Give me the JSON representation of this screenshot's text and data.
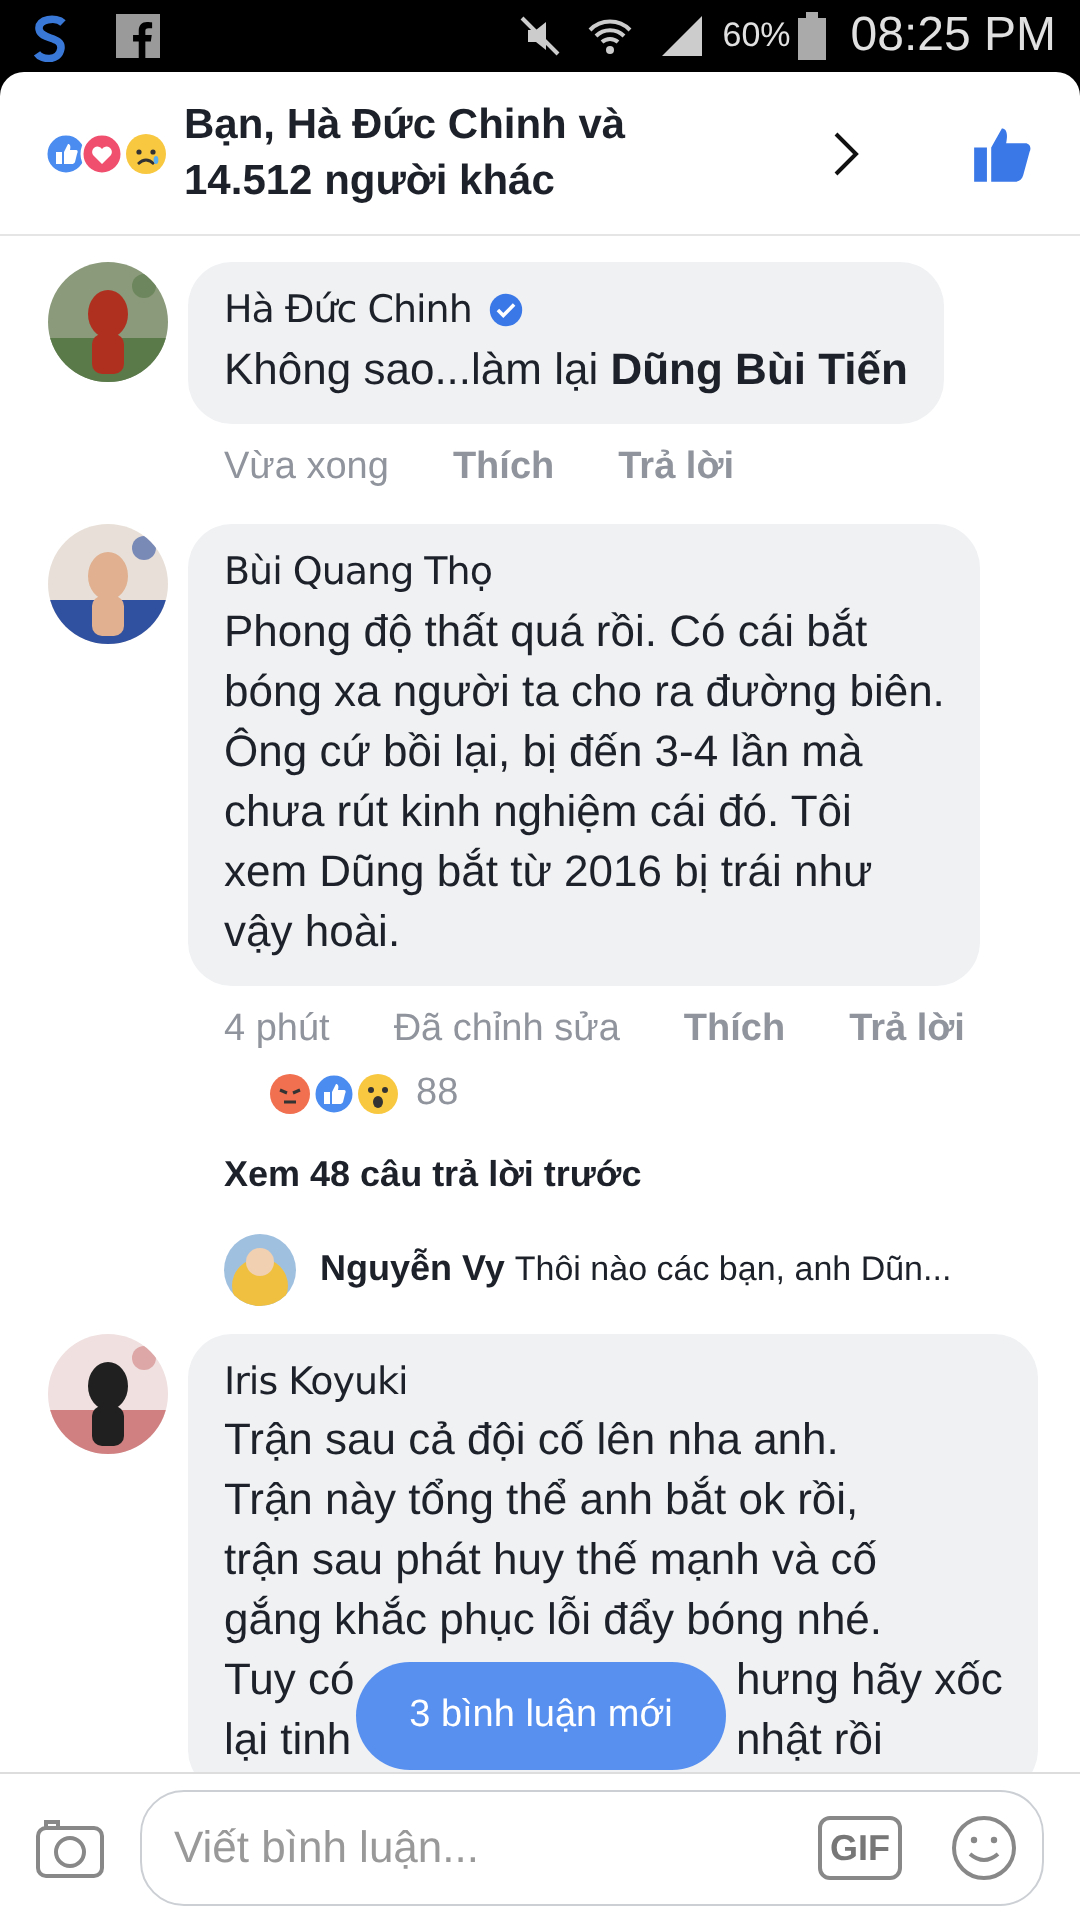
{
  "status_bar": {
    "battery": "60%",
    "time": "08:25 PM"
  },
  "reactions_header": {
    "lines": [
      "Bạn, Hà Đức Chinh và",
      "14.512 người khác"
    ]
  },
  "comments": [
    {
      "author": "Hà Đức Chinh",
      "verified": true,
      "body": [
        [
          "Không sao...làm lại **Dũng Bùi Tiến**"
        ]
      ],
      "actions": [
        "Vừa xong",
        "Thích",
        "Trả lời"
      ]
    },
    {
      "author": "Bùi Quang Thọ",
      "verified": false,
      "body": [
        [
          "Phong độ thất quá rồi. Có cái bắt"
        ],
        [
          "bóng xa người ta cho ra đường biên."
        ],
        [
          "Ông cứ bồi lại, bị đến 3-4 lần mà"
        ],
        [
          "chưa rút kinh nghiệm cái đó. Tôi"
        ],
        [
          "xem Dũng bắt từ 2016 bị trái như"
        ],
        [
          "vậy hoài."
        ]
      ],
      "actions": [
        "4 phút",
        "Đã chỉnh sửa",
        "Thích",
        "Trả lời"
      ],
      "reaction_count": "88",
      "view_more": "Xem 48 câu trả lời trước",
      "reply": {
        "author": "Nguyễn Vy",
        "text": "Thôi nào các bạn, anh Dũn..."
      }
    },
    {
      "author": "Iris Koyuki",
      "verified": false,
      "body": [
        [
          "Trận sau cả đội cố lên nha anh."
        ],
        [
          "Trận này tổng thể anh bắt ok rồi,"
        ],
        [
          "trận sau phát huy thế mạnh và cố"
        ],
        [
          "gắng khắc phục lỗi đẩy bóng nhé."
        ],
        [
          "Tuy có",
          "hưng hãy xốc"
        ],
        [
          "lại tinh",
          "nhật rồi"
        ]
      ]
    }
  ],
  "new_comments_pill": "3 bình luận mới",
  "composer": {
    "placeholder": "Viết bình luận...",
    "gif": "GIF"
  }
}
